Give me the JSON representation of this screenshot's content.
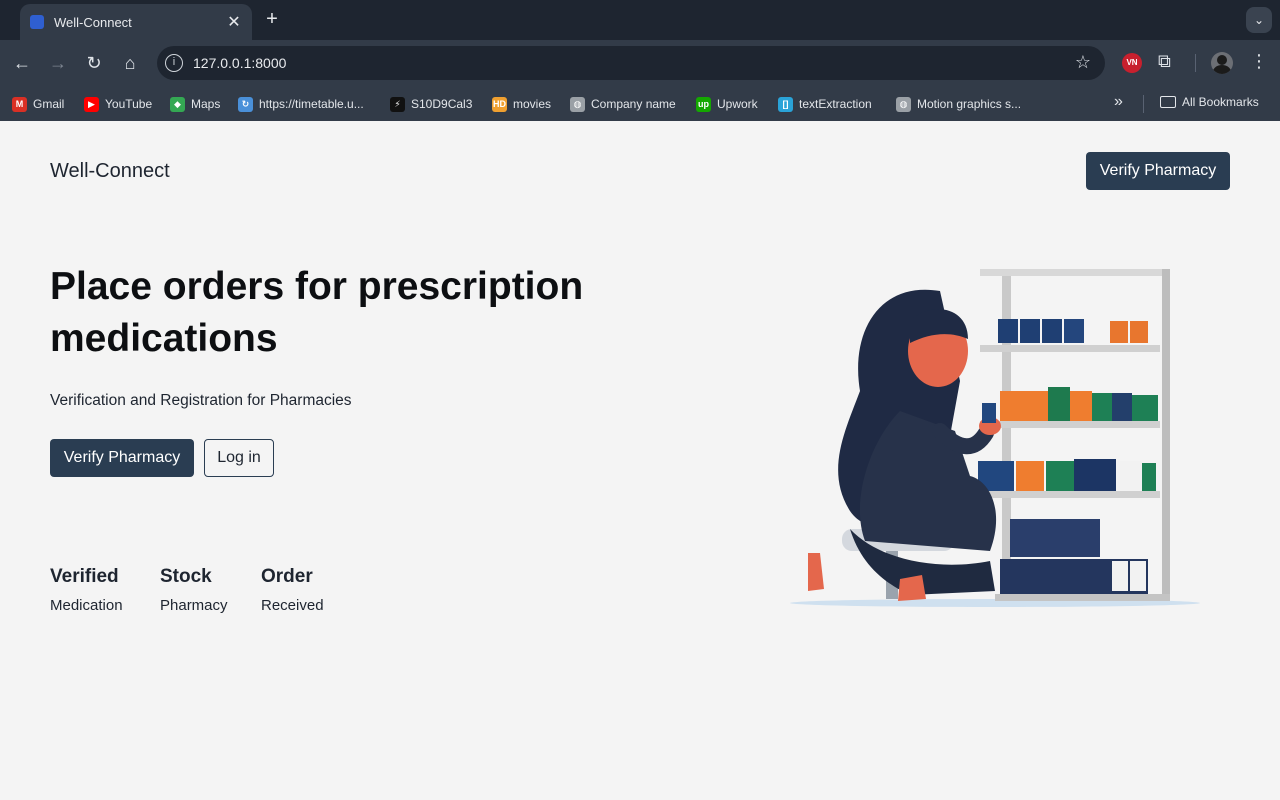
{
  "browser": {
    "tab_title": "Well-Connect",
    "tab_close": "✕",
    "new_tab": "+",
    "url": "127.0.0.1:8000",
    "bookmarks": [
      {
        "label": "Gmail",
        "icon": "gmail-icon",
        "color": "#d93025"
      },
      {
        "label": "YouTube",
        "icon": "youtube-icon",
        "color": "#ff0000"
      },
      {
        "label": "Maps",
        "icon": "maps-icon",
        "color": "#34a853"
      },
      {
        "label": "https://timetable.u...",
        "icon": "sync-icon",
        "color": "#4a90d9"
      },
      {
        "label": "S10D9Cal3",
        "icon": "bolt-icon",
        "color": "#111111"
      },
      {
        "label": "movies",
        "icon": "hd-icon",
        "color": "#f0a030"
      },
      {
        "label": "Company name",
        "icon": "globe-icon",
        "color": "#9aa0a6"
      },
      {
        "label": "Upwork",
        "icon": "upwork-icon",
        "color": "#14a800"
      },
      {
        "label": "textExtraction",
        "icon": "bracket-icon",
        "color": "#2aa3d8"
      },
      {
        "label": "Motion graphics s...",
        "icon": "globe-icon",
        "color": "#9aa0a6"
      }
    ],
    "more_bookmarks": "»",
    "all_bookmarks": "All Bookmarks"
  },
  "page": {
    "brand": "Well-Connect",
    "nav_button": "Verify Pharmacy",
    "hero_title": "Place orders for prescription medications",
    "hero_subtitle": "Verification and Registration for Pharmacies",
    "primary_cta": "Verify Pharmacy",
    "secondary_cta": "Log in",
    "stats": [
      {
        "heading": "Verified",
        "sub": "Medication"
      },
      {
        "heading": "Stock",
        "sub": "Pharmacy"
      },
      {
        "heading": "Order",
        "sub": "Received"
      }
    ]
  },
  "colors": {
    "primary": "#2a3d52",
    "background": "#f4f4f4",
    "chrome_dark": "#1e2530",
    "chrome": "#323b48"
  }
}
